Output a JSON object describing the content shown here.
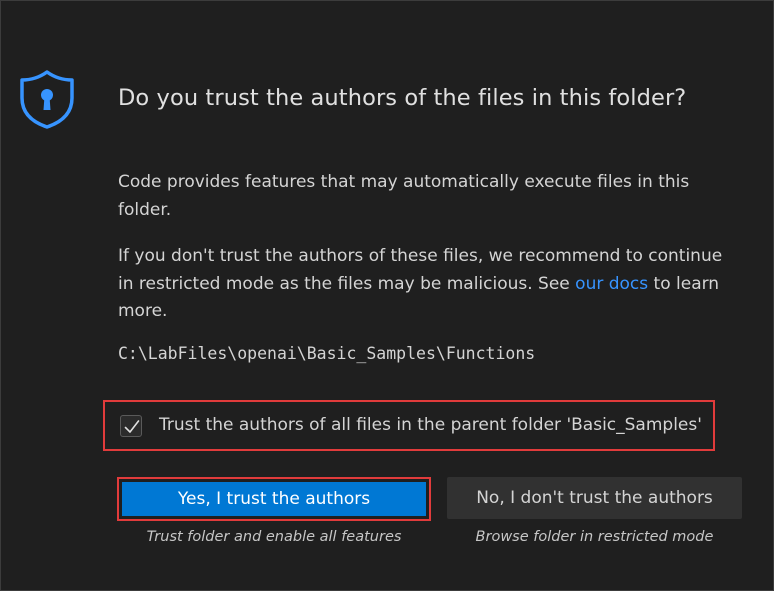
{
  "dialog": {
    "title": "Do you trust the authors of the files in this folder?",
    "paragraph1": "Code provides features that may automatically execute files in this folder.",
    "paragraph2_before_link": "If you don't trust the authors of these files, we recommend to continue in restricted mode as the files may be malicious. See ",
    "paragraph2_link": "our docs",
    "paragraph2_after_link": " to learn more.",
    "folder_path": "C:\\LabFiles\\openai\\Basic_Samples\\Functions",
    "trust_parent_label": "Trust the authors of all files in the parent folder 'Basic_Samples'",
    "trust_parent_checked": true
  },
  "buttons": {
    "trust_label": "Yes, I trust the authors",
    "trust_caption": "Trust folder and enable all features",
    "dont_trust_label": "No, I don't trust the authors",
    "dont_trust_caption": "Browse folder in restricted mode"
  },
  "icons": {
    "shield": "shield-lock-icon",
    "check": "check-icon"
  },
  "colors": {
    "accent": "#0078d4",
    "link": "#3794ff",
    "highlight_border": "#e13b3b",
    "background": "#1f1f1f"
  }
}
